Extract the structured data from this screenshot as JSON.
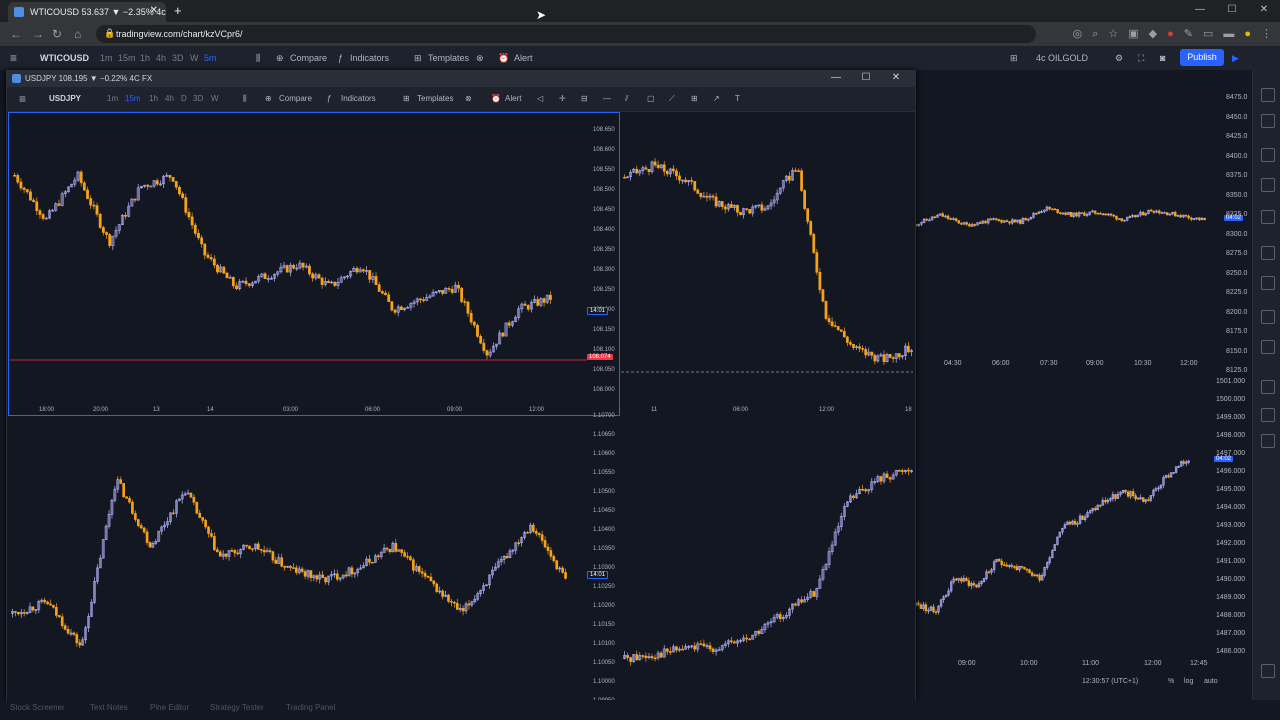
{
  "browser": {
    "tab_title": "WTICOUSD 53.637 ▼ −2.35% 4c",
    "url": "tradingview.com/chart/kzVCpr6/",
    "new_tab": "+",
    "close": "✕",
    "win_min": "—",
    "win_max": "☐",
    "win_close": "✕"
  },
  "header": {
    "symbol": "WTICOUSD",
    "timeframes": [
      "1m",
      "15m",
      "1h",
      "4h",
      "3D",
      "W",
      "5m"
    ],
    "compare": "Compare",
    "indicators": "Indicators",
    "templates": "Templates",
    "alert": "Alert",
    "layout_symbol": "4c OILGOLD",
    "publish": "Publish"
  },
  "window": {
    "title": "USDJPY 108.195 ▼ −0.22% 4C FX",
    "symbol": "USDJPY",
    "timeframes": [
      "1m",
      "15m",
      "1h",
      "4h",
      "D",
      "3D",
      "W"
    ],
    "compare": "Compare",
    "indicators": "Indicators",
    "templates": "Templates",
    "alert": "Alert"
  },
  "panes": {
    "tl": {
      "prices": [
        "108.650",
        "108.600",
        "108.550",
        "108.500",
        "108.450",
        "108.400",
        "108.350",
        "108.300",
        "108.250",
        "108.200",
        "108.150",
        "108.100",
        "108.050",
        "108.000"
      ],
      "times": [
        "18:00",
        "20:00",
        "13",
        "14",
        "03:00",
        "06:00",
        "09:00",
        "12:00"
      ],
      "last_badge": "108.074",
      "countdown": "14:01"
    },
    "tr": {
      "times": [
        "11",
        "06:00",
        "12:00",
        "18"
      ]
    },
    "bl": {
      "prices": [
        "1.10700",
        "1.10650",
        "1.10600",
        "1.10550",
        "1.10500",
        "1.10450",
        "1.10400",
        "1.10350",
        "1.10300",
        "1.10250",
        "1.10200",
        "1.10150",
        "1.10100",
        "1.10050",
        "1.10000",
        "1.09950"
      ],
      "countdown": "14:01"
    }
  },
  "back": {
    "top_prices": [
      "8475.0",
      "8450.0",
      "8425.0",
      "8400.0",
      "8375.0",
      "8350.0",
      "8325.0",
      "8300.0",
      "8275.0",
      "8250.0",
      "8225.0",
      "8200.0",
      "8175.0",
      "8150.0",
      "8125.0"
    ],
    "top_times": [
      "04:30",
      "06:00",
      "07:30",
      "09:00",
      "10:30",
      "12:00"
    ],
    "top_badge": "04:02",
    "bottom_prices": [
      "1501.000",
      "1500.000",
      "1499.000",
      "1498.000",
      "1497.000",
      "1496.000",
      "1495.000",
      "1494.000",
      "1493.000",
      "1492.000",
      "1491.000",
      "1490.000",
      "1489.000",
      "1488.000",
      "1487.000",
      "1486.000"
    ],
    "bottom_times": [
      "09:00",
      "10:00",
      "11:00",
      "12:00",
      "12:45"
    ],
    "bottom_badge": "04:02",
    "clock": "12:30:57 (UTC+1)",
    "percent": "%",
    "log": "log",
    "auto": "auto"
  },
  "bottom_tabs": [
    "Stock Screener",
    "Text Notes",
    "Pine Editor",
    "Strategy Tester",
    "Trading Panel"
  ],
  "colors": {
    "bg": "#131722",
    "bull": "#b7b7ff",
    "bear": "#f7a21b",
    "accent": "#2962ff",
    "last_price": "#f23645"
  }
}
